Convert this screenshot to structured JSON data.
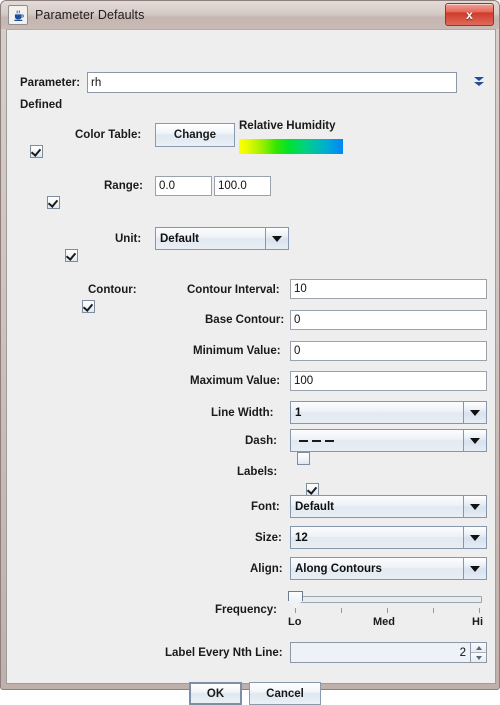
{
  "window": {
    "title": "Parameter Defaults",
    "icon": "java-coffee-cup-icon",
    "close_label": "x"
  },
  "parameter": {
    "label": "Parameter:",
    "value": "rh",
    "dropdown_icon": "double-chevron-down-icon"
  },
  "defined_label": "Defined",
  "color_table": {
    "label": "Color Table:",
    "enabled": true,
    "change_button": "Change",
    "name": "Relative Humidity",
    "gradient_stops": [
      "#ffff00",
      "#9cf000",
      "#33e600",
      "#00d47a",
      "#00a8d8",
      "#0086f5"
    ]
  },
  "range": {
    "label": "Range:",
    "enabled": true,
    "min": "0.0",
    "max": "100.0"
  },
  "unit": {
    "label": "Unit:",
    "enabled": true,
    "value": "Default"
  },
  "contour": {
    "label": "Contour:",
    "enabled": true,
    "fields": [
      {
        "label": "Contour Interval:",
        "value": "10"
      },
      {
        "label": "Base Contour:",
        "value": "0"
      },
      {
        "label": "Minimum Value:",
        "value": "0"
      },
      {
        "label": "Maximum Value:",
        "value": "100"
      }
    ],
    "line_width": {
      "label": "Line Width:",
      "value": "1"
    },
    "dash": {
      "label": "Dash:",
      "checked": false,
      "value": "_ _ _"
    },
    "labels": {
      "label": "Labels:",
      "checked": true,
      "font": {
        "label": "Font:",
        "value": "Default"
      },
      "size": {
        "label": "Size:",
        "value": "12"
      },
      "align": {
        "label": "Align:",
        "value": "Along Contours"
      },
      "frequency": {
        "label": "Frequency:",
        "value": 0,
        "ticks": [
          "Lo",
          "Med",
          "Hi"
        ]
      },
      "nth_line": {
        "label": "Label Every Nth Line:",
        "value": "2"
      }
    }
  },
  "buttons": {
    "ok": "OK",
    "cancel": "Cancel"
  }
}
